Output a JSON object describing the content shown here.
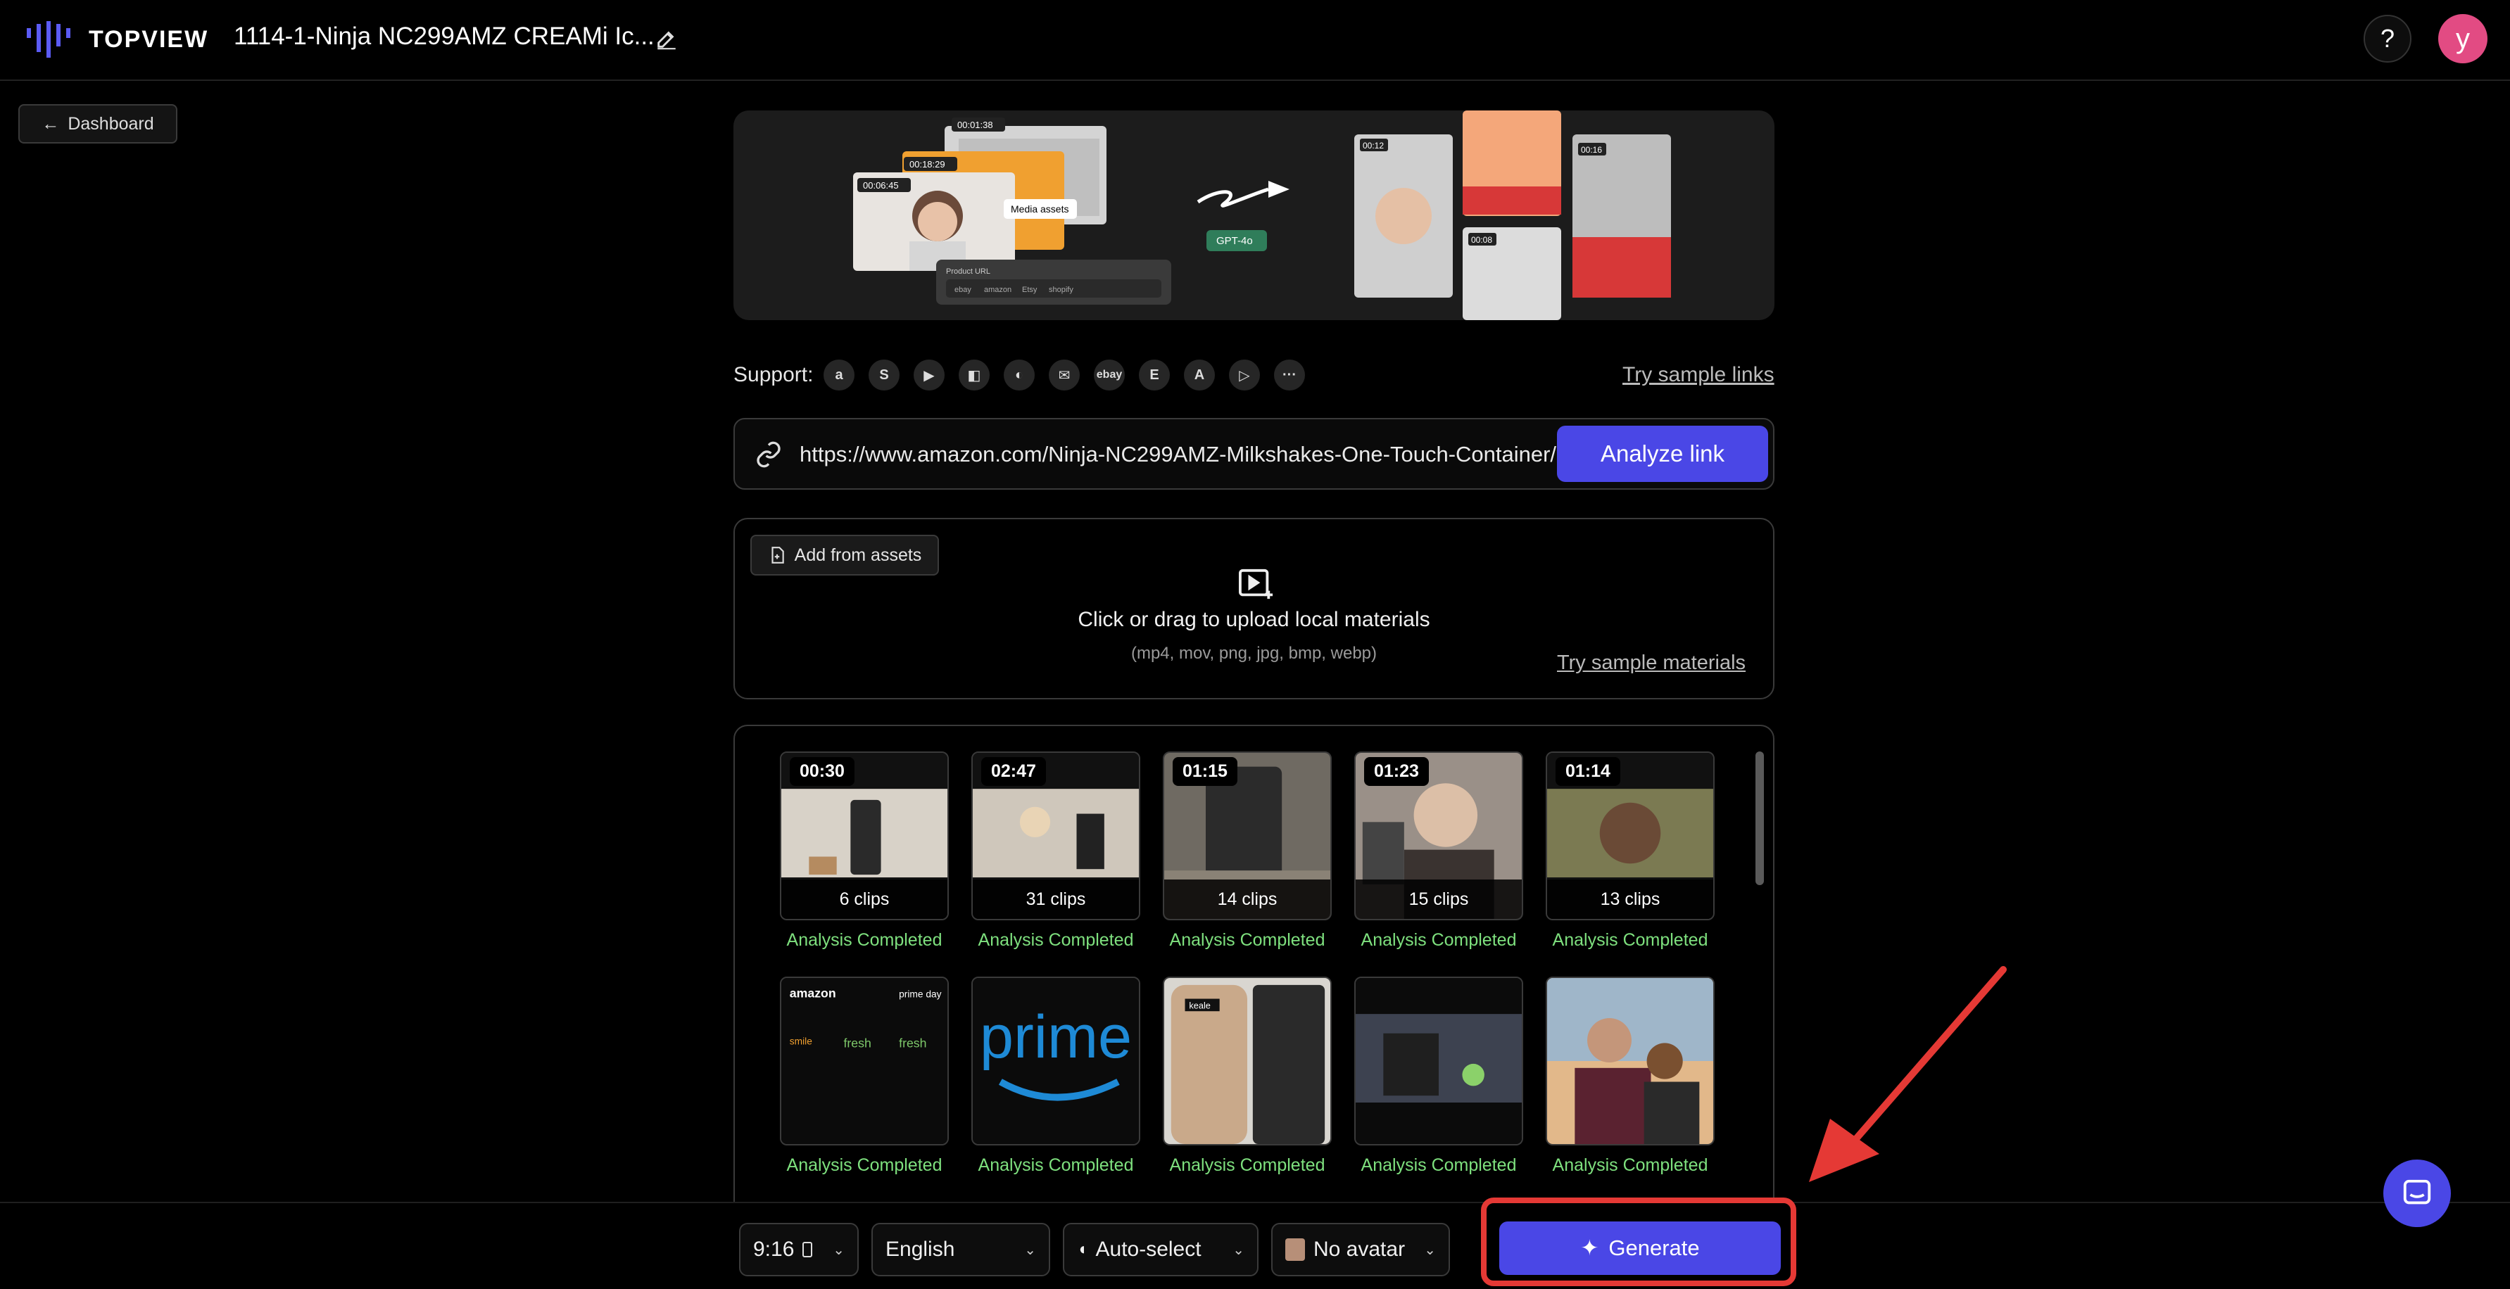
{
  "header": {
    "logo_text": "TOPVIEW",
    "project_title": "1114-1-Ninja NC299AMZ CREAMi Ic...",
    "help_label": "?",
    "avatar_initial": "y"
  },
  "nav": {
    "dashboard_label": "Dashboard"
  },
  "hero": {
    "timestamps": [
      "00:01:38",
      "00:18:29",
      "00:06:45"
    ],
    "media_assets_label": "Media assets",
    "product_url_label": "Product URL",
    "stores": [
      "ebay",
      "amazon",
      "Etsy",
      "shopify"
    ],
    "model_badge": "GPT-4o",
    "output_times": [
      "00:12",
      "00:08",
      "00:16"
    ]
  },
  "support": {
    "label": "Support:",
    "platforms": [
      "amazon-icon",
      "shopify-icon",
      "youtube-icon",
      "shop-bag-icon",
      "app-icon",
      "store-icon",
      "mail-icon",
      "ebay",
      "etsy-icon",
      "app-store-icon",
      "google-play-icon",
      "more-icon"
    ],
    "ebay_text": "ebay",
    "etsy_text": "E",
    "more_text": "···",
    "try_sample_links": "Try sample links"
  },
  "url_input": {
    "value": "https://www.amazon.com/Ninja-NC299AMZ-Milkshakes-One-Touch-Container/",
    "analyze_label": "Analyze link"
  },
  "upload": {
    "add_from_assets": "Add from assets",
    "main_text": "Click or drag to upload local materials",
    "sub_text": "(mp4, mov, png, jpg, bmp, webp)",
    "try_sample_materials": "Try sample materials"
  },
  "media": {
    "items": [
      {
        "duration": "00:30",
        "clips": "6 clips",
        "status": "Analysis Completed"
      },
      {
        "duration": "02:47",
        "clips": "31 clips",
        "status": "Analysis Completed"
      },
      {
        "duration": "01:15",
        "clips": "14 clips",
        "status": "Analysis Completed"
      },
      {
        "duration": "01:23",
        "clips": "15 clips",
        "status": "Analysis Completed"
      },
      {
        "duration": "01:14",
        "clips": "13 clips",
        "status": "Analysis Completed"
      },
      {
        "duration": "",
        "clips": "",
        "status": "Analysis Completed",
        "thumb_text": "amazon"
      },
      {
        "duration": "",
        "clips": "",
        "status": "Analysis Completed",
        "thumb_text": "prime"
      },
      {
        "duration": "",
        "clips": "",
        "status": "Analysis Completed",
        "thumb_text": "keale"
      },
      {
        "duration": "",
        "clips": "",
        "status": "Analysis Completed"
      },
      {
        "duration": "",
        "clips": "",
        "status": "Analysis Completed"
      }
    ]
  },
  "bottom_bar": {
    "aspect_ratio": "9:16",
    "language": "English",
    "voice": "Auto-select",
    "avatar": "No avatar",
    "generate_label": "Generate"
  },
  "colors": {
    "accent": "#4a47e6",
    "status_green": "#7ee07e",
    "highlight_red": "#e53935",
    "avatar_pink": "#e24b83"
  }
}
